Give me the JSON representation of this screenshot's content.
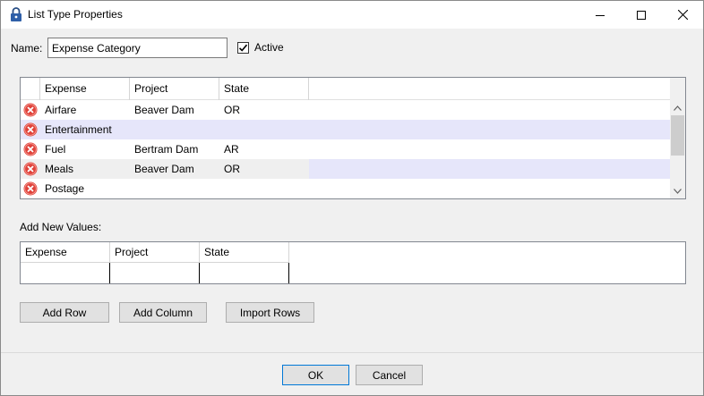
{
  "window": {
    "title": "List Type Properties",
    "icon": "padlock-icon"
  },
  "name_field": {
    "label": "Name:",
    "value": "Expense Category"
  },
  "active": {
    "label": "Active",
    "checked": true
  },
  "values_grid": {
    "columns": [
      "Expense",
      "Project",
      "State"
    ],
    "rows": [
      {
        "expense": "Airfare",
        "project": "Beaver Dam",
        "state": "OR"
      },
      {
        "expense": "Entertainment",
        "project": "",
        "state": ""
      },
      {
        "expense": "Fuel",
        "project": "Bertram Dam",
        "state": "AR"
      },
      {
        "expense": "Meals",
        "project": "Beaver Dam",
        "state": "OR"
      },
      {
        "expense": "Postage",
        "project": "",
        "state": ""
      }
    ]
  },
  "add_new": {
    "label": "Add New Values:",
    "columns": [
      "Expense",
      "Project",
      "State"
    ]
  },
  "buttons": {
    "add_row": "Add Row",
    "add_column": "Add Column",
    "import_rows": "Import Rows",
    "ok": "OK",
    "cancel": "Cancel"
  },
  "colors": {
    "selection": "#e6e6fa",
    "delete_icon": "#e0433b",
    "default_button_border": "#0078d7"
  }
}
